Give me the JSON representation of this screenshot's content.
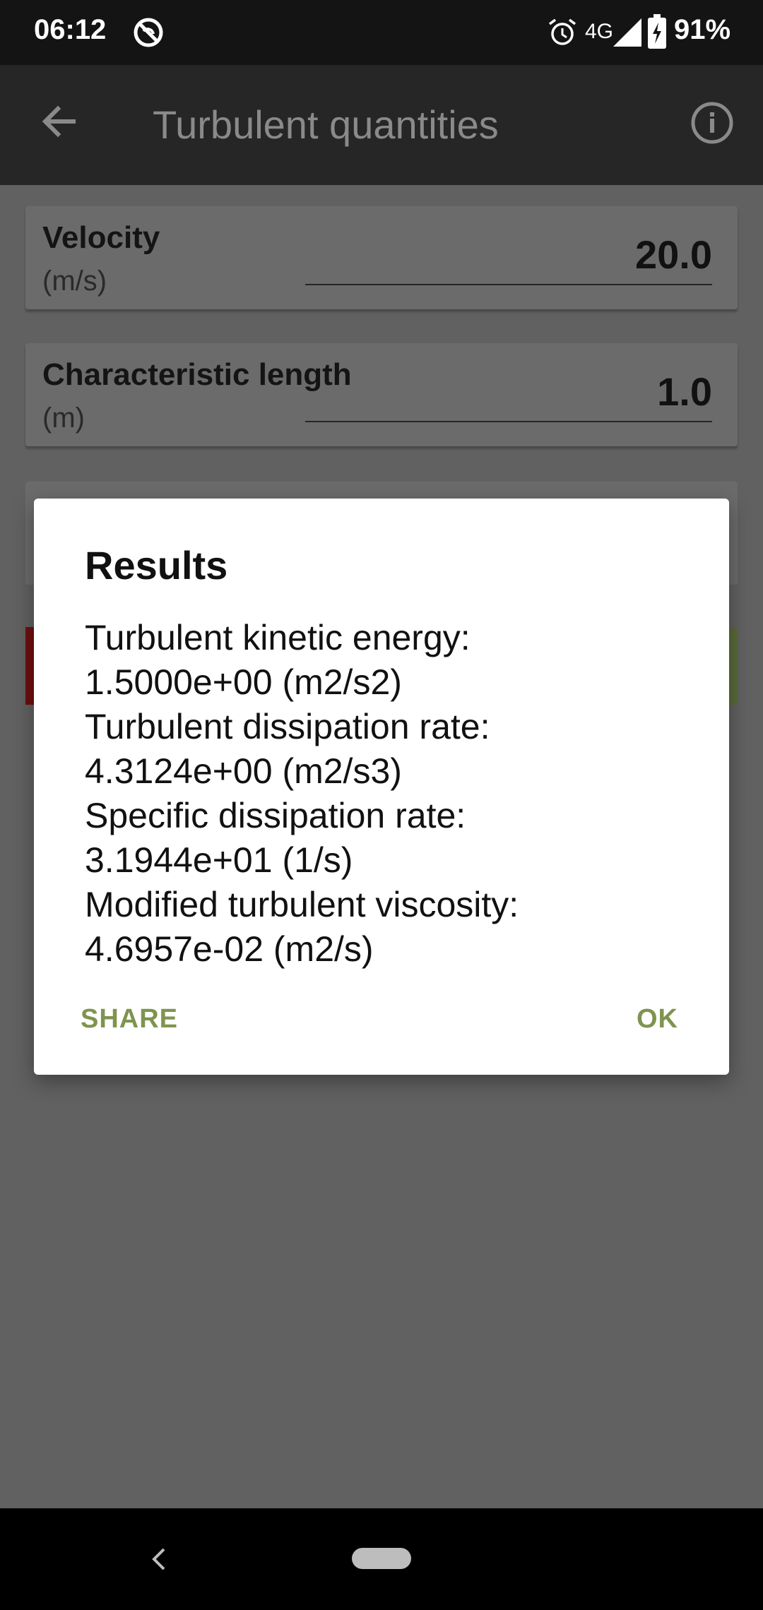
{
  "status_bar": {
    "time": "06:12",
    "network": "4G",
    "battery": "91%",
    "icons": [
      "do-not-disturb-icon",
      "alarm-icon",
      "signal-icon",
      "battery-charging-icon"
    ]
  },
  "app_bar": {
    "title": "Turbulent quantities",
    "icons": [
      "back-arrow-icon",
      "info-icon"
    ]
  },
  "inputs": [
    {
      "label": "Velocity",
      "unit": "(m/s)",
      "value": "20.0"
    },
    {
      "label": "Characteristic length",
      "unit": "(m)",
      "value": "1.0"
    }
  ],
  "dialog": {
    "title": "Results",
    "lines": [
      "Turbulent kinetic energy:",
      "1.5000e+00 (m2/s2)",
      "Turbulent dissipation rate:",
      "4.3124e+00 (m2/s3)",
      "Specific dissipation rate:",
      "3.1944e+01 (1/s)",
      "Modified turbulent viscosity:",
      "4.6957e-02 (m2/s)"
    ],
    "share_label": "SHARE",
    "ok_label": "OK"
  },
  "colors": {
    "accent": "#7f944e",
    "scrim_background": "#616161",
    "app_bar": "#262626",
    "dialog_background": "#ffffff"
  }
}
